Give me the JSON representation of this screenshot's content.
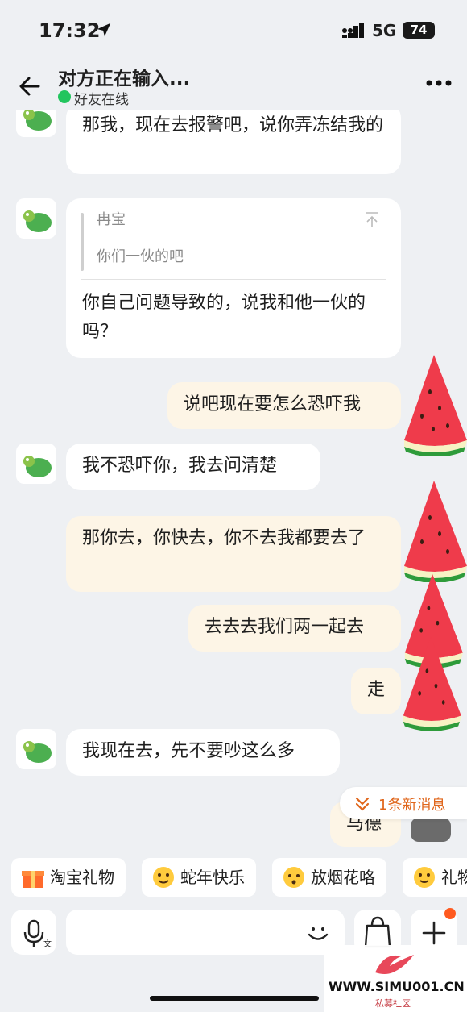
{
  "status_bar": {
    "time": "17:32",
    "network": "5G",
    "battery": "74"
  },
  "header": {
    "title": "对方正在输入...",
    "subtitle": "好友在线"
  },
  "messages": [
    {
      "side": "in",
      "text": "那我，现在去报警吧，说你弄冻结我的"
    },
    {
      "side": "in",
      "quote_name": "冉宝",
      "quote_text": "你们一伙的吧",
      "text": "你自己问题导致的，说我和他一伙的吗？"
    },
    {
      "side": "out",
      "text": "说吧现在要怎么恐吓我"
    },
    {
      "side": "in",
      "text": "我不恐吓你，我去问清楚"
    },
    {
      "side": "out",
      "text": "那你去，你快去，你不去我都要去了"
    },
    {
      "side": "out",
      "text": "去去去我们两一起去"
    },
    {
      "side": "out",
      "text": "走"
    },
    {
      "side": "in",
      "text": "我现在去，先不要吵这么多"
    },
    {
      "side": "out",
      "text": "马德"
    }
  ],
  "new_messages": "1条新消息",
  "quick_actions": [
    "淘宝礼物",
    "蛇年快乐",
    "放烟花咯",
    "礼物"
  ],
  "input": {
    "placeholder": ""
  },
  "watermark": {
    "url": "WWW.SIMU001.CN",
    "label": "私募社区"
  },
  "colors": {
    "in_bubble": "#ffffff",
    "out_bubble": "#fdf5e6",
    "online": "#22c55e",
    "accent": "#e0661b"
  }
}
